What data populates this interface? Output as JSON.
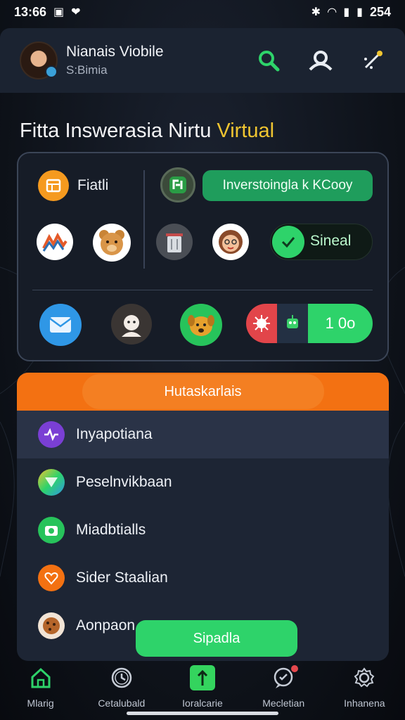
{
  "status": {
    "time": "13:66",
    "battery": "254"
  },
  "header": {
    "title": "Nianais Viobile",
    "subtitle": "S:Bimia"
  },
  "section": {
    "title_main": "Fitta Inswerasia Nirtu",
    "title_accent": "Virtual"
  },
  "panel": {
    "feature_label": "Fiatli",
    "invest_button": "Inverstoingla k KCooy",
    "toggle_label": "Sineal",
    "counter_value": "1 0o"
  },
  "list": {
    "header": "Hutaskarlais",
    "items": [
      {
        "label": "Inyapotiana"
      },
      {
        "label": "Peselnvikbaan"
      },
      {
        "label": "Miadbtialls"
      },
      {
        "label": "Sider Staalian"
      },
      {
        "label": "Aonpaon"
      }
    ]
  },
  "fab": {
    "label": "Sipadla"
  },
  "nav": [
    {
      "label": "Mlarig"
    },
    {
      "label": "Cetalubald"
    },
    {
      "label": "Ioralcarie"
    },
    {
      "label": "Mecletian"
    },
    {
      "label": "Inhanena"
    }
  ],
  "colors": {
    "accent_yellow": "#f0c531",
    "green": "#2ed36a",
    "orange": "#f37112",
    "card": "#1d2534"
  },
  "icons": {
    "header": [
      "search-icon",
      "user-icon",
      "magic-wand-icon"
    ],
    "nav": [
      "home-icon",
      "clock-icon",
      "upload-icon",
      "chat-icon",
      "settings-icon"
    ]
  }
}
